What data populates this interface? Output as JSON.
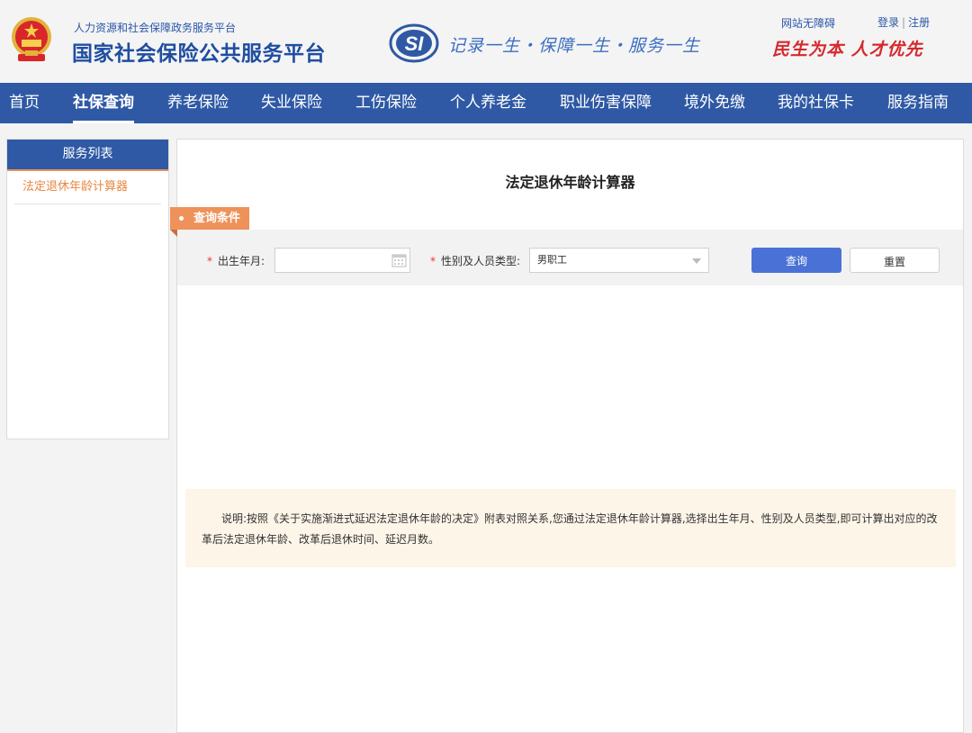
{
  "header": {
    "sub_title": "人力资源和社会保障政务服务平台",
    "main_title": "国家社会保险公共服务平台",
    "slogan": "记录一生・保障一生・服务一生",
    "accessibility_link": "网站无障碍",
    "login": "登录",
    "register": "注册",
    "red_slogan": "民生为本 人才优先",
    "si_logo_text": "SI"
  },
  "nav": {
    "items": [
      "首页",
      "社保查询",
      "养老保险",
      "失业保险",
      "工伤保险",
      "个人养老金",
      "职业伤害保障",
      "境外免缴",
      "我的社保卡",
      "服务指南"
    ],
    "active_index": 1
  },
  "sidebar": {
    "title": "服务列表",
    "items": [
      "法定退休年龄计算器"
    ]
  },
  "main": {
    "title": "法定退休年龄计算器",
    "condition_tag": "查询条件",
    "birth_label": "出生年月:",
    "birth_value": "",
    "type_label": "性别及人员类型:",
    "type_value": "男职工",
    "query_button": "查询",
    "reset_button": "重置",
    "note": "说明:按照《关于实施渐进式延迟法定退休年龄的决定》附表对照关系,您通过法定退休年龄计算器,选择出生年月、性别及人员类型,即可计算出对应的改革后法定退休年龄、改革后退休时间、延迟月数。"
  },
  "colors": {
    "brand_blue": "#2f59a5",
    "accent_orange": "#ee9259",
    "slogan_red": "#d6282c",
    "button_blue": "#4a72d6"
  },
  "icons": {
    "emblem": "national-emblem-icon",
    "si_logo": "social-insurance-logo-icon",
    "calendar": "calendar-icon",
    "caret": "chevron-down-icon"
  }
}
